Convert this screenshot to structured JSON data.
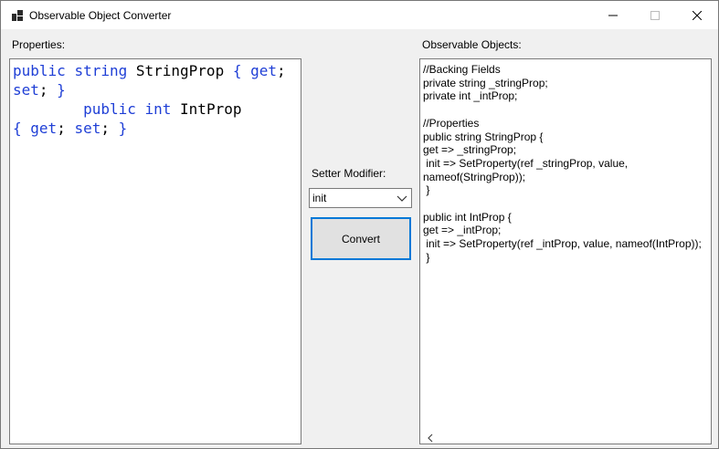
{
  "window": {
    "title": "Observable Object Converter"
  },
  "labels": {
    "properties": "Properties:",
    "observable": "Observable Objects:",
    "setter_modifier": "Setter Modifier:"
  },
  "input": {
    "code_lines": [
      [
        {
          "t": "public",
          "k": true
        },
        {
          "t": " "
        },
        {
          "t": "string",
          "k": true
        },
        {
          "t": " StringProp "
        },
        {
          "t": "{",
          "k": true
        },
        {
          "t": " "
        },
        {
          "t": "get",
          "k": true
        },
        {
          "t": ";"
        }
      ],
      [
        {
          "t": "set",
          "k": true
        },
        {
          "t": "; "
        },
        {
          "t": "}",
          "k": true
        }
      ],
      [
        {
          "t": "        "
        },
        {
          "t": "public",
          "k": true
        },
        {
          "t": " "
        },
        {
          "t": "int",
          "k": true
        },
        {
          "t": " IntProp"
        }
      ],
      [
        {
          "t": "{",
          "k": true
        },
        {
          "t": " "
        },
        {
          "t": "get",
          "k": true
        },
        {
          "t": "; "
        },
        {
          "t": "set",
          "k": true
        },
        {
          "t": "; "
        },
        {
          "t": "}",
          "k": true
        }
      ]
    ]
  },
  "setter": {
    "selected": "init"
  },
  "convert_label": "Convert",
  "output": {
    "text": "//Backing Fields\nprivate string _stringProp;\nprivate int _intProp;\n\n//Properties\npublic string StringProp {\nget => _stringProp;\n init => SetProperty(ref _stringProp, value,\nnameof(StringProp));\n }\n\npublic int IntProp {\nget => _intProp;\n init => SetProperty(ref _intProp, value, nameof(IntProp));\n }"
  },
  "colors": {
    "keyword": "#1f3fd6",
    "focus_border": "#0078d7"
  }
}
